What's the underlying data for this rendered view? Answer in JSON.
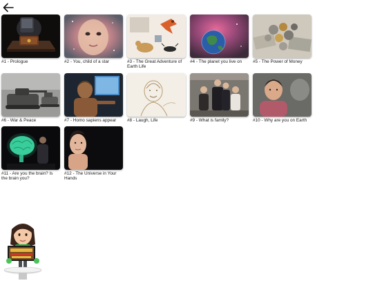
{
  "nav": {
    "back_icon": "arrow-left-icon"
  },
  "episodes": [
    {
      "label": "#1 - Prologue",
      "icon": "tv-box-on-table-thumbnail"
    },
    {
      "label": "#2 - You, child of a star",
      "icon": "child-face-nebula-thumbnail"
    },
    {
      "label": "#3 - The Great Adventure of Earth Life",
      "icon": "animals-collage-thumbnail"
    },
    {
      "label": "#4 - The planet you live on",
      "icon": "earth-nebula-thumbnail"
    },
    {
      "label": "#5 - The Power of Money",
      "icon": "coins-banknotes-thumbnail"
    },
    {
      "label": "#6 - War & Peace",
      "icon": "tanks-thumbnail"
    },
    {
      "label": "#7 - Homo sapiens appear",
      "icon": "early-human-thumbnail"
    },
    {
      "label": "#8 - Laugh, Life",
      "icon": "sketch-portrait-thumbnail"
    },
    {
      "label": "#9 - What is family?",
      "icon": "family-portrait-thumbnail"
    },
    {
      "label": "#10 - Why are you on Earth",
      "icon": "boy-portrait-thumbnail"
    },
    {
      "label": "#11 - Are you the brain? Is the brain you?",
      "icon": "glowing-brain-thumbnail"
    },
    {
      "label": "#12 - The Universe in Your Hands",
      "icon": "girl-looking-up-thumbnail"
    }
  ],
  "host": {
    "icon": "mii-host-icon"
  }
}
